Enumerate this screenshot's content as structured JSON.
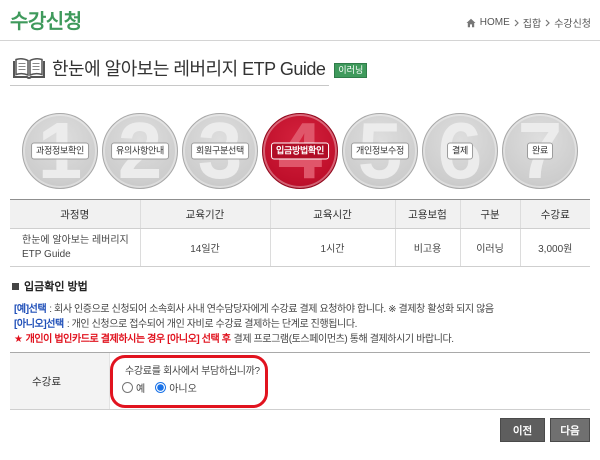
{
  "page": {
    "title": "수강신청"
  },
  "breadcrumb": {
    "home_icon": "home-icon",
    "separator_icon": "chevron-right-icon",
    "items": [
      "HOME",
      "집합",
      "수강신청"
    ]
  },
  "course": {
    "icon": "book-icon",
    "title": "한눈에 알아보는 레버리지 ETP Guide",
    "badge": "이러닝"
  },
  "steps": [
    {
      "num": "1",
      "label": "과정정보확인"
    },
    {
      "num": "2",
      "label": "유의사항안내"
    },
    {
      "num": "3",
      "label": "회원구분선택"
    },
    {
      "num": "4",
      "label": "입금방법확인"
    },
    {
      "num": "5",
      "label": "개인정보수정"
    },
    {
      "num": "6",
      "label": "결제"
    },
    {
      "num": "7",
      "label": "완료"
    }
  ],
  "active_step": 4,
  "course_table": {
    "headers": [
      "과정명",
      "교육기간",
      "교육시간",
      "고용보험",
      "구분",
      "수강료"
    ],
    "rows": [
      [
        "한눈에 알아보는 레버리지 ETP Guide",
        "14일간",
        "1시간",
        "비고용",
        "이러닝",
        "3,000원"
      ]
    ]
  },
  "payment_info": {
    "bullet_icon": "square-bullet-icon",
    "heading": "입금확인 방법",
    "yes_label": "[예]선택",
    "yes_text": ": 회사 인증으로 신청되어 소속회사 사내 연수담당자에게 수강료 결제 요청하야 합니다. ※ 결제창 활성화 되지 않음",
    "no_label": "[아니오]선택",
    "no_text": ": 개인 신청으로 접수되어 개인 자비로 수강료 결제하는 단계로 진행됩니다.",
    "notice_star": "★",
    "notice_emphasis": "개인이 법인카드로 결제하시는 경우 [아니오] 선택 후",
    "notice_text": "결제 프로그램(토스페이먼츠) 통해 결제하시기 바랍니다."
  },
  "fee_form": {
    "label": "수강료",
    "question": "수강료를 회사에서 부담하십니까?",
    "options": [
      {
        "label": "예",
        "checked": false
      },
      {
        "label": "아니오",
        "checked": true
      }
    ]
  },
  "buttons": {
    "prev": "이전",
    "next": "다음"
  },
  "colors": {
    "brand": "#3f9a5c",
    "active": "#c3122e",
    "alert": "#e1131f",
    "link_blue": "#1f4fb8"
  }
}
